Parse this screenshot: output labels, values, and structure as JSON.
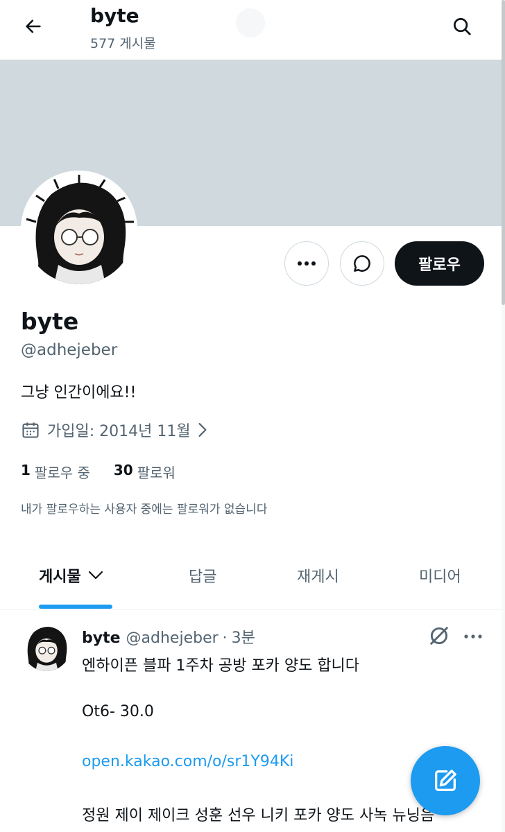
{
  "header": {
    "title": "byte",
    "post_count": "577 게시물"
  },
  "profile": {
    "name": "byte",
    "handle": "@adhejeber",
    "bio": "그냥 인간이에요!!",
    "joined": "가입일: 2014년 11월",
    "following_count": "1",
    "following_label": "팔로우 중",
    "followers_count": "30",
    "followers_label": "팔로워",
    "mutual_note": "내가 팔로우하는 사용자 중에는 팔로워가 없습니다",
    "follow_button": "팔로우"
  },
  "tabs": [
    {
      "label": "게시물",
      "active": true
    },
    {
      "label": "답글",
      "active": false
    },
    {
      "label": "재게시",
      "active": false
    },
    {
      "label": "미디어",
      "active": false
    }
  ],
  "post": {
    "name": "byte",
    "handle": "@adhejeber",
    "separator": "·",
    "time": "3분",
    "lines": [
      "엔하이픈 블파 1주차 공방 포카 양도 합니다",
      "Ot6- 30.0",
      "open.kakao.com/o/sr1Y94Ki",
      "정원 제이 제이크 성훈 선우 니키 포카 양도 사녹 뉴닝음"
    ]
  },
  "colors": {
    "accent": "#1d9bf0",
    "banner": "#cfd9de",
    "text_primary": "#0f1419",
    "text_secondary": "#536471"
  },
  "icons": [
    "back-arrow-icon",
    "search-icon",
    "more-icon",
    "message-icon",
    "calendar-icon",
    "chevron-right-icon",
    "chevron-down-icon",
    "unpin-icon",
    "compose-icon"
  ]
}
